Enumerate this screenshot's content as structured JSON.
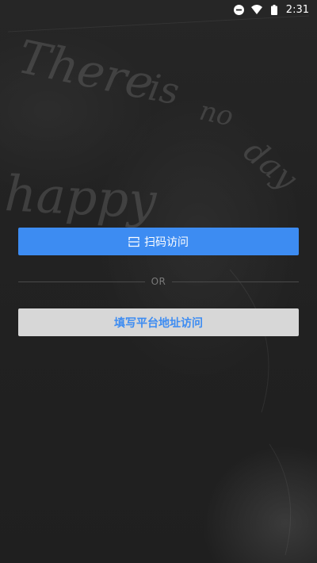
{
  "status_bar": {
    "time": "2:31",
    "icons": [
      "do-not-disturb-icon",
      "wifi-icon",
      "battery-icon"
    ]
  },
  "background": {
    "chalk_words": [
      "There",
      "is",
      "no",
      "day",
      "happy"
    ]
  },
  "actions": {
    "scan_label": "扫码访问",
    "scan_icon": "scan-icon",
    "divider_label": "OR",
    "address_label": "填写平台地址访问"
  },
  "colors": {
    "accent": "#3d8cf2",
    "secondary_button": "#d7d7d7",
    "background": "#1f1f1f"
  }
}
